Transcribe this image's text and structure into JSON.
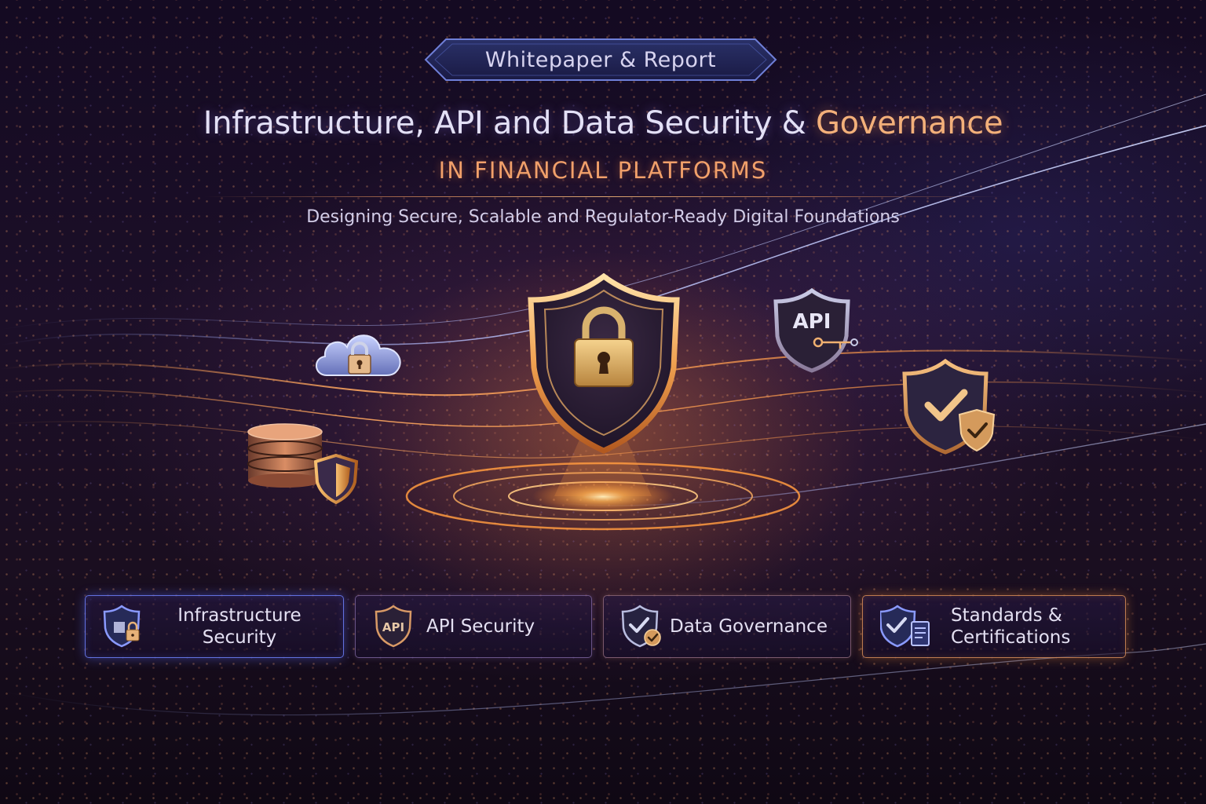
{
  "header": {
    "badge_label": "Whitepaper & Report",
    "title_main": "Infrastructure, API and Data Security & ",
    "title_accent": "Governance",
    "subtitle": "IN FINANCIAL PLATFORMS",
    "tagline": "Designing Secure, Scalable and Regulator-Ready Digital Foundations"
  },
  "illustration": {
    "api_shield_text": "API",
    "icons": [
      "cloud-lock-icon",
      "database-shield-icon",
      "central-shield-lock-icon",
      "api-shield-icon",
      "check-shield-icon"
    ]
  },
  "pillars": [
    {
      "line1": "Infrastructure",
      "line2": "Security",
      "icon": "infrastructure-shield-icon"
    },
    {
      "line1": "API Security",
      "line2": "",
      "icon": "api-shield-icon",
      "icon_text": "API"
    },
    {
      "line1": "Data Governance",
      "line2": "",
      "icon": "data-governance-shield-icon"
    },
    {
      "line1": "Standards &",
      "line2": "Certifications",
      "icon": "standards-document-icon"
    }
  ],
  "colors": {
    "accent_orange": "#f3b07a",
    "accent_blue": "#6e82ff",
    "text_light": "#e3e0f6",
    "background": "#140a22"
  }
}
